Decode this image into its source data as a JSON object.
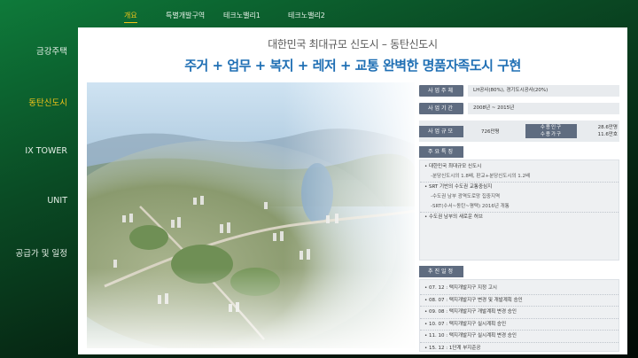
{
  "topnav": {
    "tabs": [
      {
        "label": "개요",
        "active": true
      },
      {
        "label": "특별개발구역",
        "active": false
      },
      {
        "label": "테크노밸리1",
        "active": false
      },
      {
        "label": "테크노밸리2",
        "active": false
      }
    ]
  },
  "sidebar": {
    "items": [
      {
        "label": "금강주택",
        "active": false
      },
      {
        "label": "동탄신도시",
        "active": true
      },
      {
        "label": "IX TOWER",
        "active": false
      },
      {
        "label": "UNIT",
        "active": false
      },
      {
        "label": "공급가 및 일정",
        "active": false
      }
    ]
  },
  "hero": {
    "title": "대한민국 최대규모 신도시 – 동탄신도시",
    "subtitle": "주거 + 업무 + 복지 + 레저 + 교통 완벽한 명품자족도시 구현"
  },
  "info": {
    "developer": {
      "label": "사업주체",
      "value": "LH공사(80%), 경기도시공사(20%)"
    },
    "period": {
      "label": "사업기간",
      "value": "2008년 ~ 2015년"
    },
    "scale": {
      "label": "사업규모",
      "area": "726만평",
      "sub_label_1": "수용인구",
      "sub_label_2": "수용가구",
      "population": "28.6만명",
      "households": "11.6만호"
    },
    "features": {
      "label": "주요특징",
      "items": [
        {
          "text": "• 대한민국 최대규모 신도시",
          "sub": false,
          "sep": false
        },
        {
          "text": "-분당신도시의 1.8배, 판교+분당신도시의 1.2배",
          "sub": true,
          "sep": true
        },
        {
          "text": "• SRT 기반의 수도권 교통중심지",
          "sub": false,
          "sep": false
        },
        {
          "text": "-수도권 남부 광역도로망 집중지역",
          "sub": true,
          "sep": false
        },
        {
          "text": "-SRT(수서~동탄~평택) 2016년 개통",
          "sub": true,
          "sep": true
        },
        {
          "text": "• 수도권 남부의 새로운 허브",
          "sub": false,
          "sep": false
        }
      ]
    },
    "schedule": {
      "label": "추진일정",
      "items": [
        "• 07. 12 : 택지개발지구 지정 고시",
        "• 08. 07 : 택지개발지구 변경 및 개발계획 승인",
        "• 09. 08 : 택지개발지구 개발계획 변경 승인",
        "• 10. 07 : 택지개발지구 실시계획 승인",
        "• 11. 10 : 택지개발지구 실시계획 변경 승인",
        "• 15. 12 : 1단계 부지준공"
      ]
    }
  }
}
